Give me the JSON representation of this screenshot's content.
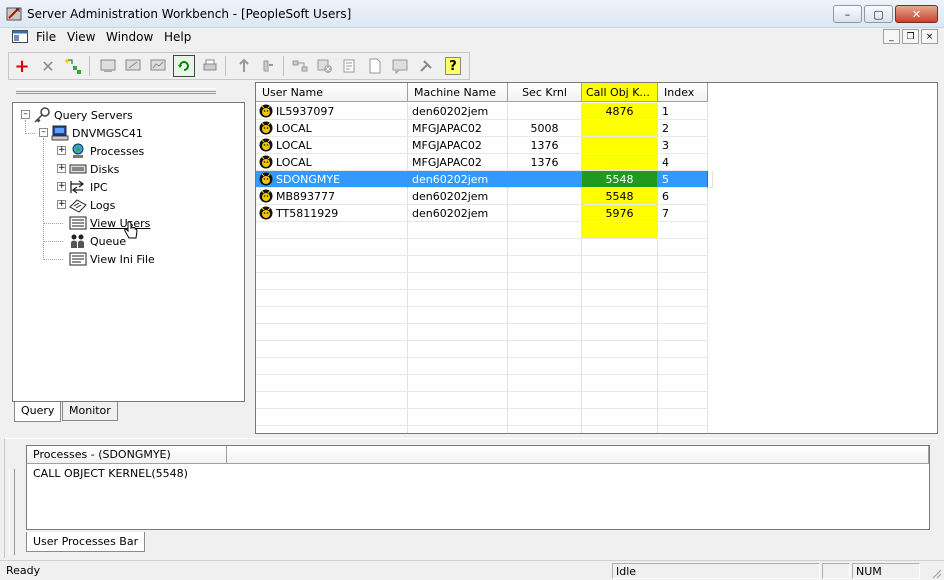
{
  "window": {
    "title": "Server Administration Workbench - [PeopleSoft Users]",
    "minimize": "–",
    "maximize": "▢",
    "close": "✕"
  },
  "menu": {
    "items": [
      "File",
      "View",
      "Window",
      "Help"
    ],
    "mdi": {
      "minimize": "_",
      "restore": "❐",
      "close": "×"
    }
  },
  "tree": {
    "root": "Query Servers",
    "server": "DNVMGSC41",
    "items": [
      {
        "label": "Processes",
        "icon": "globe-icon",
        "expandable": true
      },
      {
        "label": "Disks",
        "icon": "disk-icon",
        "expandable": true
      },
      {
        "label": "IPC",
        "icon": "ipc-icon",
        "expandable": true
      },
      {
        "label": "Logs",
        "icon": "logs-icon",
        "expandable": true
      },
      {
        "label": "View Users",
        "icon": "view-users-icon",
        "expandable": false
      },
      {
        "label": "Queue",
        "icon": "queue-icon",
        "expandable": false
      },
      {
        "label": "View Ini File",
        "icon": "ini-file-icon",
        "expandable": false
      }
    ]
  },
  "left_tabs": [
    "Query",
    "Monitor"
  ],
  "grid": {
    "columns": [
      "User Name",
      "Machine Name",
      "Sec Krnl",
      "Call Obj K...",
      "Index"
    ],
    "rows": [
      {
        "user": "IL5937097",
        "machine": "den60202jem",
        "sec": "",
        "call": "4876",
        "index": "1"
      },
      {
        "user": "LOCAL",
        "machine": "MFGJAPAC02",
        "sec": "5008",
        "call": "",
        "index": "2"
      },
      {
        "user": "LOCAL",
        "machine": "MFGJAPAC02",
        "sec": "1376",
        "call": "",
        "index": "3"
      },
      {
        "user": "LOCAL",
        "machine": "MFGJAPAC02",
        "sec": "1376",
        "call": "",
        "index": "4"
      },
      {
        "user": "SDONGMYE",
        "machine": "den60202jem",
        "sec": "",
        "call": "5548",
        "index": "5"
      },
      {
        "user": "MB893777",
        "machine": "den60202jem",
        "sec": "",
        "call": "5548",
        "index": "6"
      },
      {
        "user": "TT5811929",
        "machine": "den60202jem",
        "sec": "",
        "call": "5976",
        "index": "7"
      }
    ],
    "selected_row": 4,
    "highlight_color": "#ffff00",
    "selection_color": "#3399ff"
  },
  "processes_panel": {
    "header": "Processes - (SDONGMYE)",
    "line": "CALL OBJECT KERNEL(5548)",
    "tab": "User Processes Bar"
  },
  "status": {
    "left": "Ready",
    "mid": "Idle",
    "num": "NUM"
  }
}
